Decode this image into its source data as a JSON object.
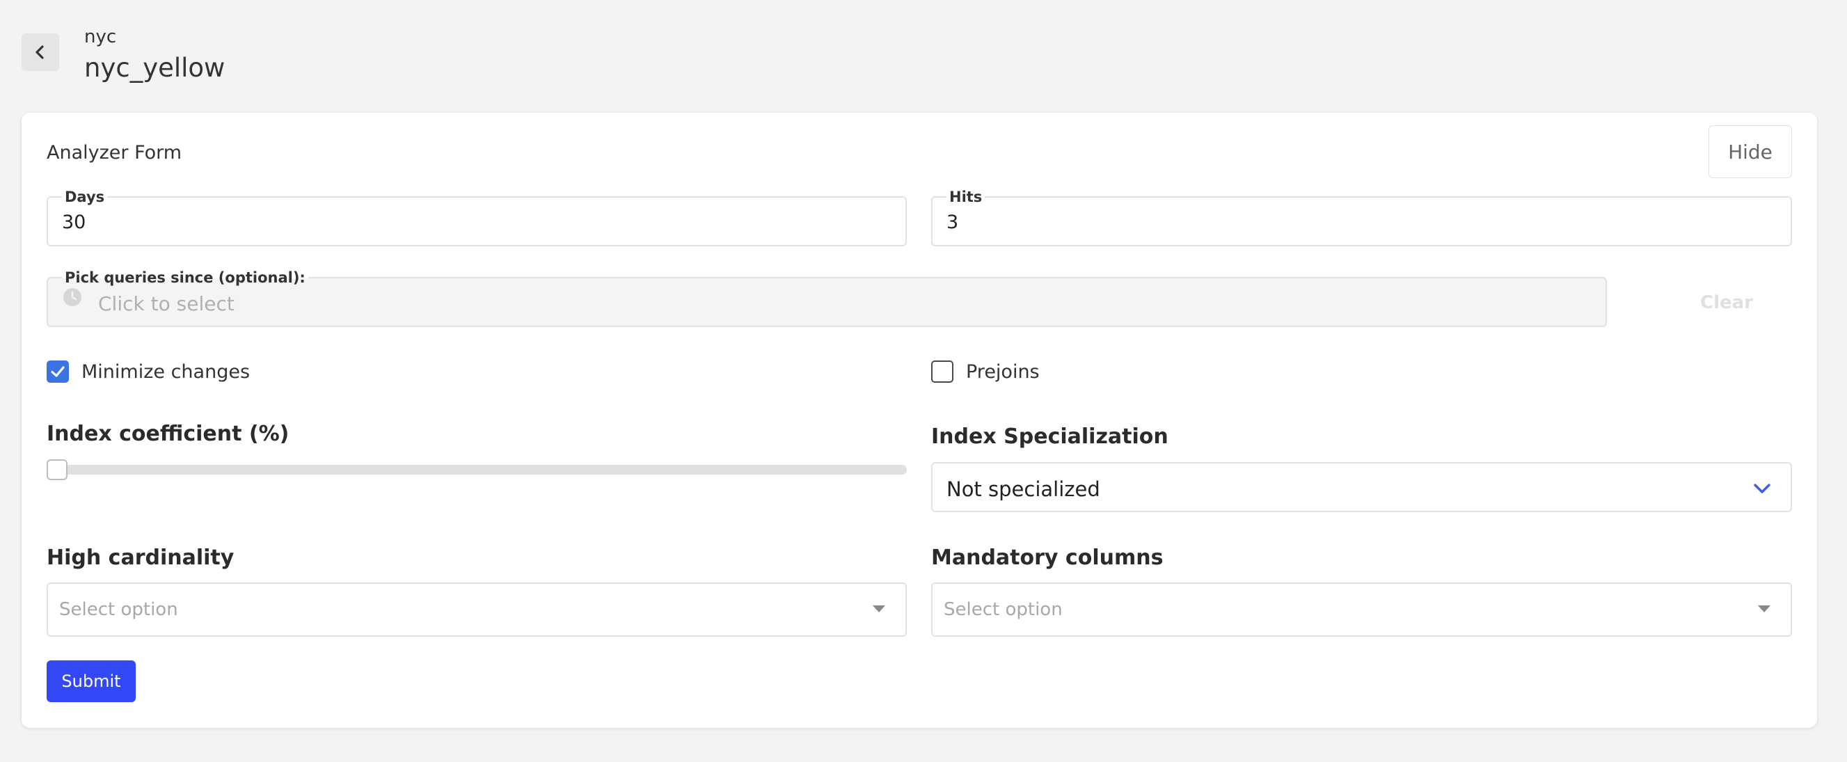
{
  "header": {
    "breadcrumb": "nyc",
    "title": "nyc_yellow"
  },
  "form": {
    "title": "Analyzer Form",
    "hide_label": "Hide",
    "days": {
      "label": "Days",
      "value": "30"
    },
    "hits": {
      "label": "Hits",
      "value": "3"
    },
    "since": {
      "label": "Pick queries since (optional):",
      "placeholder": "Click to select"
    },
    "clear_label": "Clear",
    "minimize_changes": {
      "label": "Minimize changes",
      "checked": true
    },
    "prejoins": {
      "label": "Prejoins",
      "checked": false
    },
    "index_coefficient": {
      "label": "Index coefficient (%)",
      "value": 0
    },
    "index_specialization": {
      "label": "Index Specialization",
      "value": "Not specialized"
    },
    "high_cardinality": {
      "label": "High cardinality",
      "placeholder": "Select option"
    },
    "mandatory_columns": {
      "label": "Mandatory columns",
      "placeholder": "Select option"
    },
    "submit_label": "Submit"
  },
  "colors": {
    "accent": "#3b73e0",
    "submit": "#3247f5",
    "background": "#f2f3f5"
  },
  "icons": {
    "back": "chevron-left-icon",
    "clock": "clock-icon",
    "check": "check-icon",
    "dropdown": "chevron-down-icon",
    "caret": "caret-down-icon"
  }
}
